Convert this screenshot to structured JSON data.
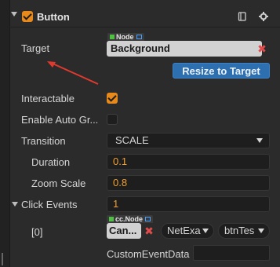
{
  "component": {
    "title": "Button",
    "enabled": true,
    "icons": [
      "book-icon",
      "gear-icon"
    ]
  },
  "target": {
    "label": "Target",
    "type_tag": "Node",
    "value": "Background",
    "clear": "✖"
  },
  "resize_button": "Resize to Target",
  "interactable": {
    "label": "Interactable",
    "checked": true
  },
  "auto_gray": {
    "label": "Enable Auto Gr...",
    "checked": false
  },
  "transition": {
    "label": "Transition",
    "value": "SCALE"
  },
  "duration": {
    "label": "Duration",
    "value": "0.1"
  },
  "zoom_scale": {
    "label": "Zoom Scale",
    "value": "0.8"
  },
  "click_events": {
    "label": "Click Events",
    "count": "1",
    "items": [
      {
        "index": "[0]",
        "type_tag": "cc.Node",
        "target": "Can...",
        "clear": "✖",
        "component": "NetExa",
        "handler": "btnTes",
        "custom_label": "CustomEventData",
        "custom_value": ""
      }
    ]
  },
  "colors": {
    "accent": "#e8891c",
    "button_blue": "#2e6fb0",
    "number": "#f0a030",
    "remove": "#e04b4b",
    "arrow": "#e03a2f"
  }
}
